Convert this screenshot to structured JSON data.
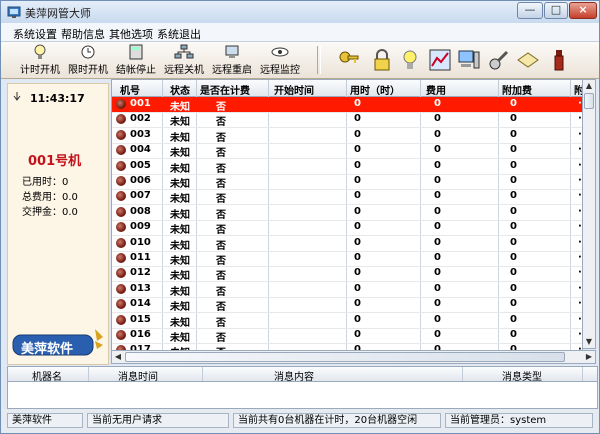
{
  "window": {
    "title": "美萍网管大师",
    "minimize_label": "—",
    "maximize_label": "□",
    "close_label": "×"
  },
  "menu": [
    "系统设置",
    "帮助信息",
    "其他选项",
    "系统退出"
  ],
  "toolbar": {
    "buttons": [
      "计时开机",
      "限时开机",
      "结帐停止",
      "远程关机",
      "远程重启",
      "远程监控"
    ],
    "icon_names": [
      "key-icon",
      "lock-icon",
      "bulb-icon",
      "chart-icon",
      "computer-icon",
      "wrench-icon",
      "book-icon",
      "bottle-icon"
    ]
  },
  "left": {
    "time": "11:43:17",
    "machine": "001号机",
    "stats": [
      "已用时：0",
      "总费用：0.0",
      "交押金：0.0"
    ],
    "logo_text": "美萍软件"
  },
  "grid": {
    "headers": [
      "机号",
      "状态",
      "是否在计费",
      "开始时间",
      "用时（时）",
      "费用",
      "附加费",
      "附"
    ],
    "rows": [
      [
        "001",
        "未知",
        "否",
        "",
        "0",
        "0",
        "0",
        "·"
      ],
      [
        "002",
        "未知",
        "否",
        "",
        "0",
        "0",
        "0",
        "·"
      ],
      [
        "003",
        "未知",
        "否",
        "",
        "0",
        "0",
        "0",
        "·"
      ],
      [
        "004",
        "未知",
        "否",
        "",
        "0",
        "0",
        "0",
        "·"
      ],
      [
        "005",
        "未知",
        "否",
        "",
        "0",
        "0",
        "0",
        "·"
      ],
      [
        "006",
        "未知",
        "否",
        "",
        "0",
        "0",
        "0",
        "·"
      ],
      [
        "007",
        "未知",
        "否",
        "",
        "0",
        "0",
        "0",
        "·"
      ],
      [
        "008",
        "未知",
        "否",
        "",
        "0",
        "0",
        "0",
        "·"
      ],
      [
        "009",
        "未知",
        "否",
        "",
        "0",
        "0",
        "0",
        "·"
      ],
      [
        "010",
        "未知",
        "否",
        "",
        "0",
        "0",
        "0",
        "·"
      ],
      [
        "011",
        "未知",
        "否",
        "",
        "0",
        "0",
        "0",
        "·"
      ],
      [
        "012",
        "未知",
        "否",
        "",
        "0",
        "0",
        "0",
        "·"
      ],
      [
        "013",
        "未知",
        "否",
        "",
        "0",
        "0",
        "0",
        "·"
      ],
      [
        "014",
        "未知",
        "否",
        "",
        "0",
        "0",
        "0",
        "·"
      ],
      [
        "015",
        "未知",
        "否",
        "",
        "0",
        "0",
        "0",
        "·"
      ],
      [
        "016",
        "未知",
        "否",
        "",
        "0",
        "0",
        "0",
        "·"
      ],
      [
        "017",
        "未知",
        "否",
        "",
        "0",
        "0",
        "0",
        "·"
      ]
    ],
    "selected_row": 0,
    "selected_color": "#ff1a00"
  },
  "messages": {
    "headers": [
      "机器名",
      "消息时间",
      "消息内容",
      "消息类型"
    ]
  },
  "status": [
    "美萍软件",
    "当前无用户请求",
    "当前共有0台机器在计时，20台机器空闲",
    "当前管理员：system"
  ]
}
